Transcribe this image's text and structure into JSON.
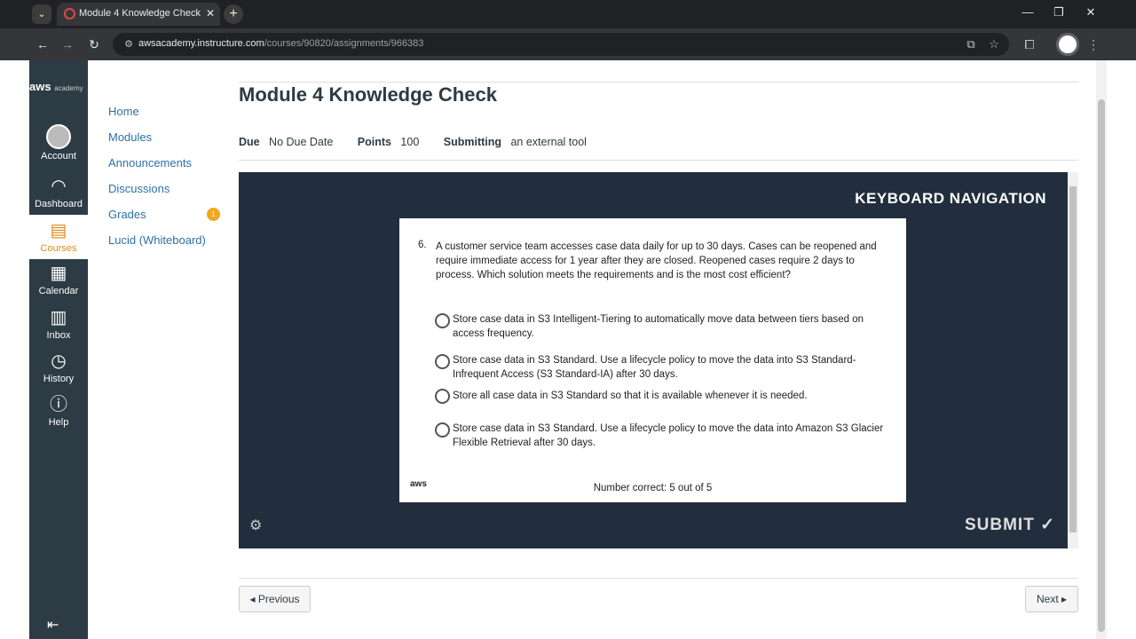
{
  "browser": {
    "tab_title": "Module 4 Knowledge Check",
    "url_domain": "awsacademy.instructure.com",
    "url_path": "/courses/90820/assignments/966383"
  },
  "global_nav": {
    "logo_text": "aws",
    "logo_sub": "academy",
    "items": [
      {
        "label": "Account",
        "icon": "avatar"
      },
      {
        "label": "Dashboard",
        "icon": "dashboard-icon"
      },
      {
        "label": "Courses",
        "icon": "courses-icon"
      },
      {
        "label": "Calendar",
        "icon": "calendar-icon"
      },
      {
        "label": "Inbox",
        "icon": "inbox-icon"
      },
      {
        "label": "History",
        "icon": "history-icon"
      },
      {
        "label": "Help",
        "icon": "help-icon"
      }
    ]
  },
  "course_nav": {
    "items": [
      "Home",
      "Modules",
      "Announcements",
      "Discussions",
      "Grades",
      "Lucid (Whiteboard)"
    ],
    "grades_badge": "1"
  },
  "assignment": {
    "title": "Module 4 Knowledge Check",
    "due_label": "Due",
    "due_value": "No Due Date",
    "points_label": "Points",
    "points_value": "100",
    "submitting_label": "Submitting",
    "submitting_value": "an external tool"
  },
  "quiz": {
    "keyboard_nav": "KEYBOARD NAVIGATION",
    "question_number": "6.",
    "question": "A customer service team accesses case data daily for up to 30 days. Cases can be reopened and require immediate access for 1 year after they are closed. Reopened cases require 2 days to process. Which solution meets the requirements and is the most cost efficient?",
    "options": [
      "Store case data in S3 Intelligent-Tiering to automatically move data between tiers based on access frequency.",
      "Store case data in S3 Standard. Use a lifecycle policy to move the data into S3 Standard-Infrequent Access (S3 Standard-IA) after 30 days.",
      "Store all case data in S3 Standard so that it is available whenever it is needed.",
      "Store case data in S3 Standard. Use a lifecycle policy to move the data into Amazon S3 Glacier Flexible Retrieval after 30 days."
    ],
    "aws_logo": "aws",
    "score": "Number correct: 5 out of 5",
    "submit": "SUBMIT ✓"
  },
  "pager": {
    "previous": "◂ Previous",
    "next": "Next ▸"
  }
}
